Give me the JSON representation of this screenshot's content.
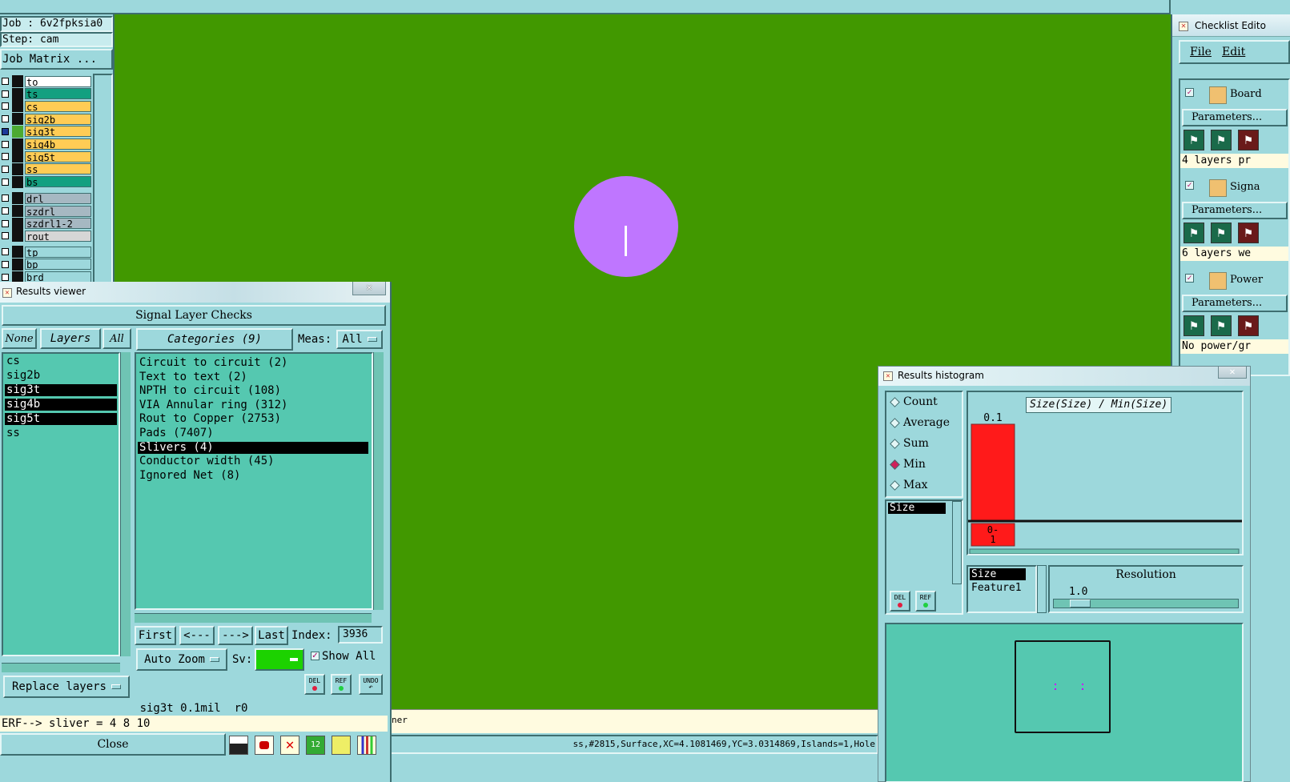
{
  "colors": {
    "panel": "#9dd8dc",
    "list": "#55c8b0",
    "canvas": "#419800",
    "selection": "#000000",
    "histogram_bar": "#ff1a1a",
    "pad": "#bf76ff"
  },
  "job": {
    "job_label": "Job : 6v2fpksia0",
    "step_label": "Step: cam",
    "matrix_button": "Job Matrix ..."
  },
  "layers": [
    {
      "name": "to",
      "color": "#ffffff"
    },
    {
      "name": "ts",
      "color": "#13a080"
    },
    {
      "name": "cs",
      "color": "#ffcc55"
    },
    {
      "name": "sig2b",
      "color": "#ffcc55"
    },
    {
      "name": "sig3t",
      "color": "#ffcc55",
      "active": true
    },
    {
      "name": "sig4b",
      "color": "#ffcc55"
    },
    {
      "name": "sig5t",
      "color": "#ffcc55"
    },
    {
      "name": "ss",
      "color": "#ffcc55"
    },
    {
      "name": "bs",
      "color": "#13a080"
    },
    {
      "name": "drl",
      "color": "#a6b8c2"
    },
    {
      "name": "szdrl",
      "color": "#a6b8c2"
    },
    {
      "name": "szdrl1-2",
      "color": "#a6b8c2"
    },
    {
      "name": "rout",
      "color": "#d6d6d6"
    },
    {
      "name": "tp",
      "color": "#9dd8dc"
    },
    {
      "name": "bp",
      "color": "#9dd8dc"
    },
    {
      "name": "brd",
      "color": "#9dd8dc"
    }
  ],
  "results_viewer": {
    "title": "Results viewer",
    "header": "Signal Layer Checks",
    "none_label": "None",
    "layers_label": "Layers",
    "all_label": "All",
    "categories_label": "Categories (9)",
    "meas_label": "Meas:",
    "meas_value": "All",
    "layer_list": [
      {
        "name": "cs",
        "selected": false
      },
      {
        "name": "sig2b",
        "selected": false
      },
      {
        "name": "sig3t",
        "selected": true
      },
      {
        "name": "sig4b",
        "selected": true
      },
      {
        "name": "sig5t",
        "selected": true
      },
      {
        "name": "ss",
        "selected": false
      }
    ],
    "categories": [
      {
        "label": "Circuit to circuit (2)",
        "selected": false
      },
      {
        "label": "Text to text (2)",
        "selected": false
      },
      {
        "label": "NPTH to circuit (108)",
        "selected": false
      },
      {
        "label": "VIA Annular ring (312)",
        "selected": false
      },
      {
        "label": "Rout to Copper (2753)",
        "selected": false
      },
      {
        "label": "Pads (7407)",
        "selected": false
      },
      {
        "label": "Slivers (4)",
        "selected": true
      },
      {
        "label": "Conductor width (45)",
        "selected": false
      },
      {
        "label": "Ignored Net (8)",
        "selected": false
      }
    ],
    "nav": {
      "first": "First",
      "prev": "<---",
      "next": "--->",
      "last": "Last",
      "index_label": "Index:",
      "index_value": "3936"
    },
    "zoom_value": "Auto Zoom",
    "sv_label": "Sv:",
    "show_all_label": "Show All",
    "show_all_checked": true,
    "replace_value": "Replace layers",
    "del_label": "DEL",
    "ref_label": "REF",
    "undo_label": "UNDO",
    "status_line": "sig3t 0.1mil  r0",
    "erf_line": "ERF--> sliver = 4 8 10",
    "close_label": "Close"
  },
  "status_bar": {
    "left_text": "ner",
    "right_text": "ss,#2815,Surface,XC=4.1081469,YC=3.0314869,Islands=1,Hole"
  },
  "checklist": {
    "title": "Checklist Edito",
    "menu": [
      "File",
      "Edit"
    ],
    "items": [
      {
        "name": "Board",
        "params": "Parameters...",
        "summary": "4 layers pr",
        "icon": "board-check-icon"
      },
      {
        "name": "Signa",
        "params": "Parameters...",
        "summary": "6 layers we",
        "icon": "signal-check-icon"
      },
      {
        "name": "Power",
        "params": "Parameters...",
        "summary": "No power/gr",
        "icon": "power-check-icon"
      }
    ]
  },
  "histogram": {
    "title": "Results histogram",
    "modes": [
      "Count",
      "Average",
      "Sum",
      "Min",
      "Max"
    ],
    "selected_mode": "Min",
    "field_list": [
      "Size"
    ],
    "chart_title": "Size(Size) / Min(Size)",
    "bar_value_label": "0.1",
    "bin_label": "0-\n1",
    "attr_list": [
      "Size",
      "Feature1"
    ],
    "resolution_label": "Resolution",
    "resolution_value": "1.0",
    "del_label": "DEL",
    "ref_label": "REF"
  },
  "chart_data": {
    "type": "bar",
    "title": "Size(Size) / Min(Size)",
    "categories": [
      "0-1"
    ],
    "values": [
      0.1
    ],
    "xlabel": "",
    "ylabel": ""
  }
}
